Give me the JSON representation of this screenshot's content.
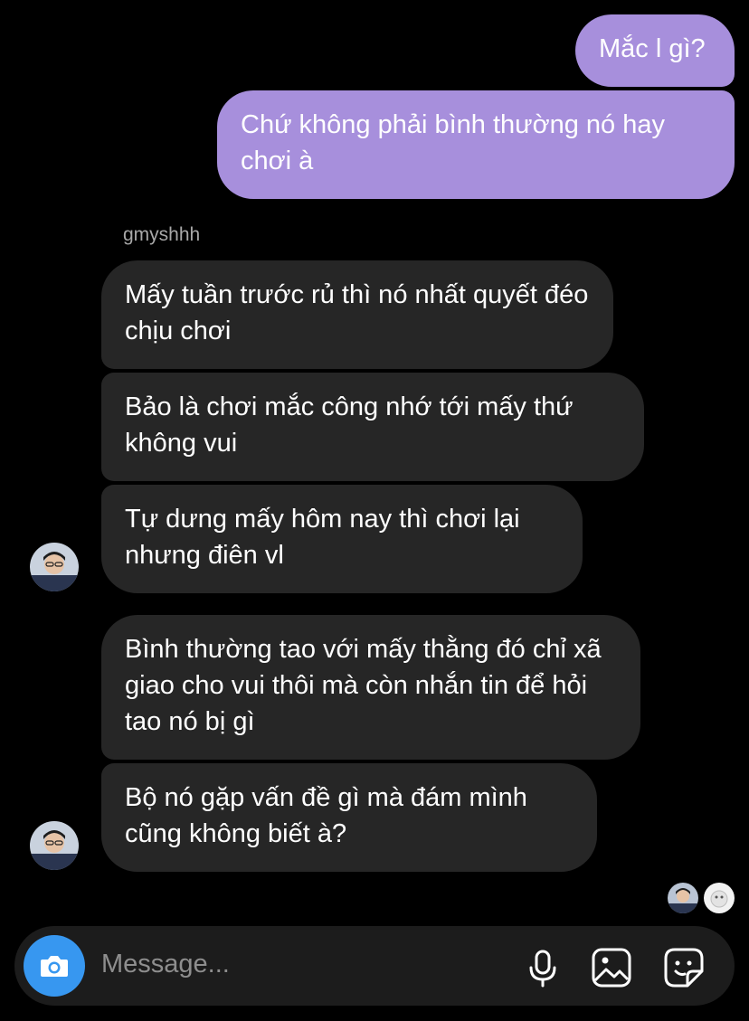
{
  "messages": {
    "outgoing": [
      "Mắc l gì?",
      "Chứ không phải bình thường nó hay chơi à"
    ],
    "sender_name": "gmyshhh",
    "incoming": [
      "Mấy tuần trước rủ thì nó nhất quyết đéo chịu chơi",
      "Bảo là chơi mắc công nhớ tới mấy thứ không vui",
      "Tự dưng mấy hôm nay thì chơi lại nhưng điên vl",
      "Bình thường tao với mấy thằng đó chỉ xã giao cho vui thôi mà còn nhắn tin để hỏi tao nó bị gì",
      "Bộ nó gặp vấn đề gì mà đám mình cũng không biết à?"
    ]
  },
  "composer": {
    "placeholder": "Message...",
    "icons": [
      "camera-icon",
      "microphone-icon",
      "gallery-icon",
      "sticker-icon"
    ]
  },
  "colors": {
    "outgoing_bubble": "#a78fdc",
    "incoming_bubble": "#262626",
    "camera_button": "#3797f0",
    "background": "#000000"
  }
}
